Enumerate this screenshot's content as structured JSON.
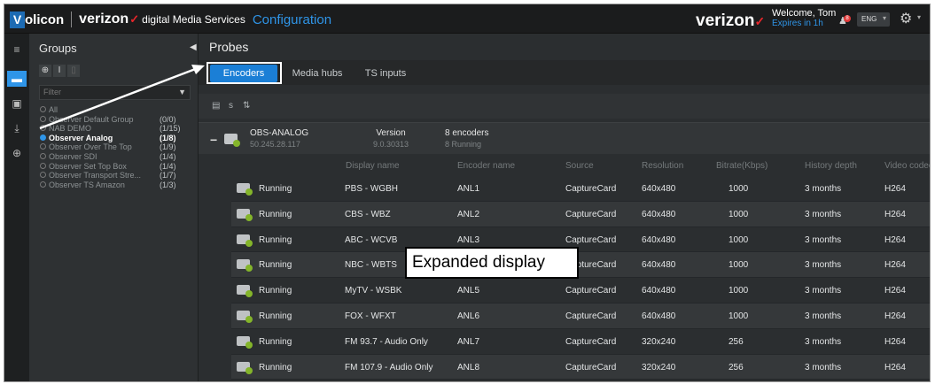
{
  "header": {
    "logo_v": "V",
    "logo_text": "olicon",
    "brand_verizon": "verizon",
    "brand_check": "✓",
    "brand_dms": "digital Media Services",
    "section": "Configuration",
    "right_verizon": "verizon",
    "welcome": "Welcome, Tom",
    "expires": "Expires in 1h",
    "notification_count": "8",
    "language": "ENG"
  },
  "rail": {
    "icons": [
      "menu-icon",
      "probe-icon",
      "monitor-icon",
      "download-icon",
      "network-icon"
    ]
  },
  "groups": {
    "title": "Groups",
    "filter_placeholder": "Filter",
    "items": [
      {
        "label": "All",
        "count": ""
      },
      {
        "label": "Observer Default Group",
        "count": "(0/0)"
      },
      {
        "label": "NAB DEMO",
        "count": "(1/15)"
      },
      {
        "label": "Observer Analog",
        "count": "(1/8)"
      },
      {
        "label": "Observer Over The Top",
        "count": "(1/9)"
      },
      {
        "label": "Observer SDI",
        "count": "(1/4)"
      },
      {
        "label": "Observer Set Top Box",
        "count": "(1/4)"
      },
      {
        "label": "Observer Transport Stre...",
        "count": "(1/7)"
      },
      {
        "label": "Observer TS Amazon",
        "count": "(1/3)"
      }
    ],
    "selected_index": 3
  },
  "main": {
    "title": "Probes",
    "tabs": [
      "Encoders",
      "Media hubs",
      "TS inputs"
    ],
    "toolbar": [
      "s"
    ],
    "probe": {
      "name": "OBS-ANALOG",
      "ip": "50.245.28.117",
      "version_label": "Version",
      "version": "9.0.30313",
      "encoders": "8 encoders",
      "running": "8 Running"
    },
    "columns": [
      "Display name",
      "Encoder name",
      "Source",
      "Resolution",
      "Bitrate(Kbps)",
      "History depth",
      "Video codec"
    ],
    "rows": [
      {
        "status": "Running",
        "display": "PBS - WGBH",
        "encoder": "ANL1",
        "source": "CaptureCard",
        "resolution": "640x480",
        "bitrate": "1000",
        "history": "3 months",
        "codec": "H264"
      },
      {
        "status": "Running",
        "display": "CBS - WBZ",
        "encoder": "ANL2",
        "source": "CaptureCard",
        "resolution": "640x480",
        "bitrate": "1000",
        "history": "3 months",
        "codec": "H264"
      },
      {
        "status": "Running",
        "display": "ABC - WCVB",
        "encoder": "ANL3",
        "source": "CaptureCard",
        "resolution": "640x480",
        "bitrate": "1000",
        "history": "3 months",
        "codec": "H264"
      },
      {
        "status": "Running",
        "display": "NBC - WBTS",
        "encoder": "ANL4",
        "source": "CaptureCard",
        "resolution": "640x480",
        "bitrate": "1000",
        "history": "3 months",
        "codec": "H264"
      },
      {
        "status": "Running",
        "display": "MyTV - WSBK",
        "encoder": "ANL5",
        "source": "CaptureCard",
        "resolution": "640x480",
        "bitrate": "1000",
        "history": "3 months",
        "codec": "H264"
      },
      {
        "status": "Running",
        "display": "FOX - WFXT",
        "encoder": "ANL6",
        "source": "CaptureCard",
        "resolution": "640x480",
        "bitrate": "1000",
        "history": "3 months",
        "codec": "H264"
      },
      {
        "status": "Running",
        "display": "FM 93.7 - Audio Only",
        "encoder": "ANL7",
        "source": "CaptureCard",
        "resolution": "320x240",
        "bitrate": "256",
        "history": "3 months",
        "codec": "H264"
      },
      {
        "status": "Running",
        "display": "FM 107.9 - Audio Only",
        "encoder": "ANL8",
        "source": "CaptureCard",
        "resolution": "320x240",
        "bitrate": "256",
        "history": "3 months",
        "codec": "H264"
      }
    ]
  },
  "annotation": {
    "callout": "Expanded display"
  }
}
